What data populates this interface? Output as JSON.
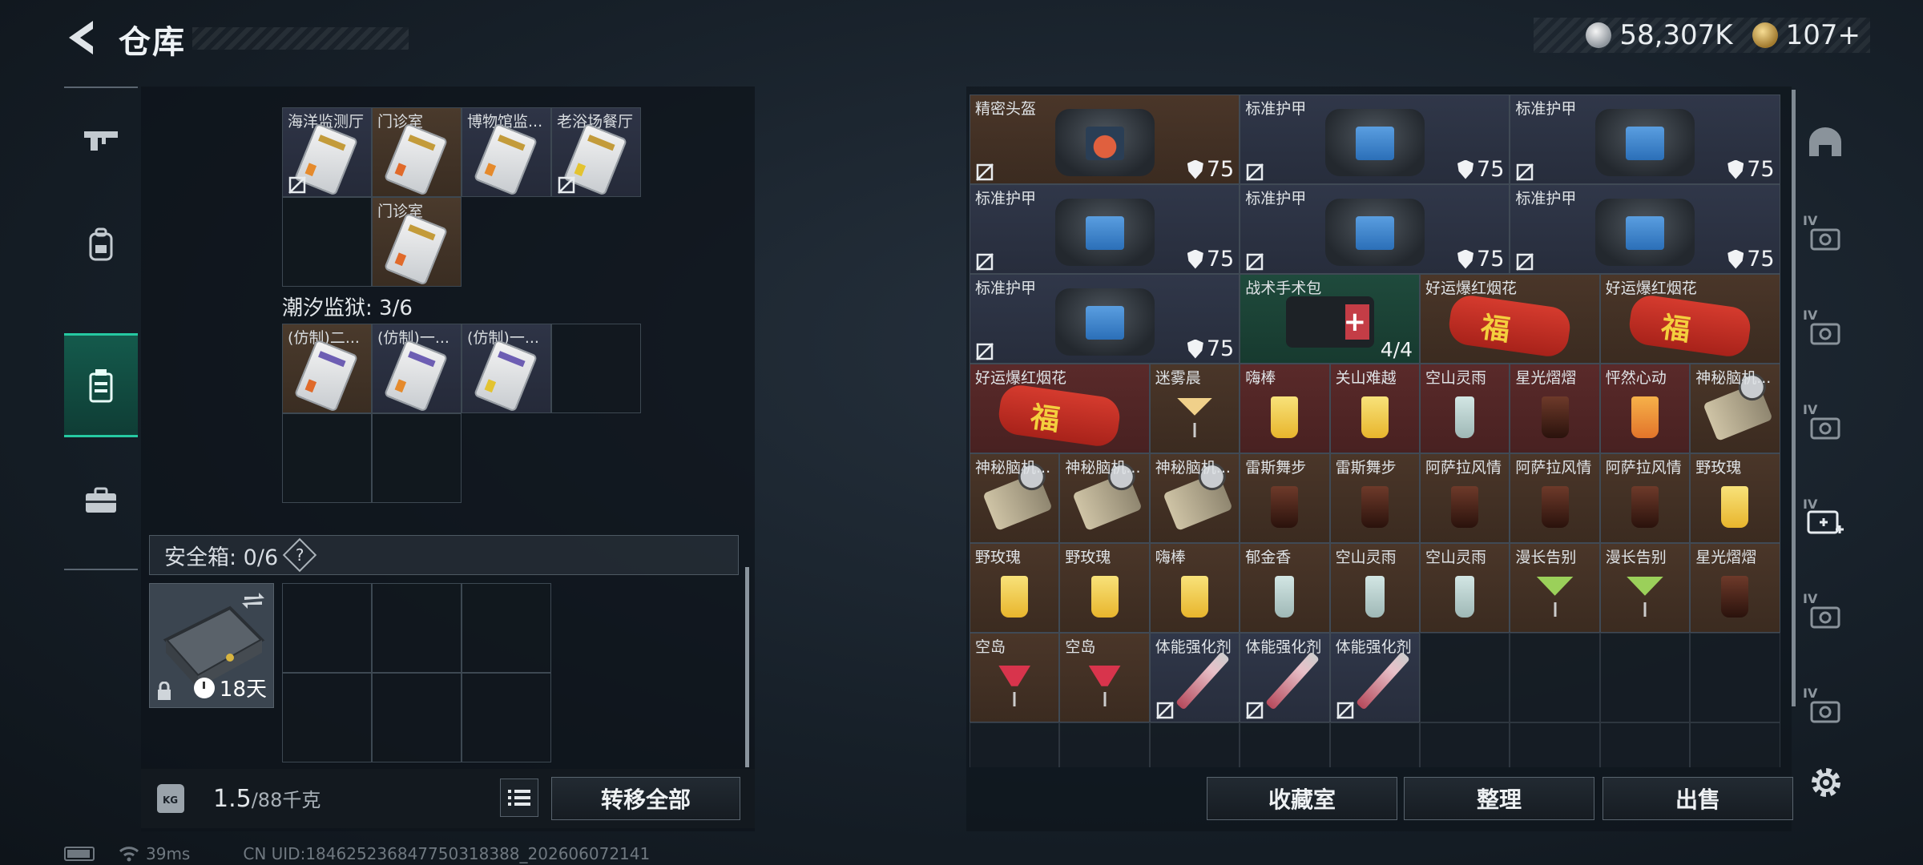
{
  "header": {
    "title": "仓库"
  },
  "currency": {
    "silver": "58,307K",
    "gold": "107+"
  },
  "left_nav": [
    {
      "name": "weapon",
      "icon": "gun-icon"
    },
    {
      "name": "backpack",
      "icon": "backpack-icon"
    },
    {
      "name": "container",
      "icon": "container-icon"
    },
    {
      "name": "briefcase",
      "icon": "briefcase-icon"
    }
  ],
  "keycards_top": {
    "row1": [
      "海洋监测厅",
      "门诊室",
      "博物馆监...",
      "老浴场餐厅"
    ],
    "row2": [
      "",
      "门诊室"
    ]
  },
  "tide_prison": {
    "label": "潮汐监狱: 3/6",
    "items": [
      "(仿制)二...",
      "(仿制)一...",
      "(仿制)一..."
    ]
  },
  "safebox": {
    "label": "安全箱: 0/6",
    "help": "?",
    "days": "18天"
  },
  "weight": {
    "current": "1.5",
    "max": "/88千克",
    "badge": "KG"
  },
  "buttons": {
    "transfer_all": "转移全部",
    "collection": "收藏室",
    "organize": "整理",
    "sell": "出售"
  },
  "status": {
    "latency": "39ms",
    "uid": "CN UID:1846252368477503183​88_202606072141"
  },
  "warehouse": {
    "big_rows": [
      [
        {
          "label": "精密头盔",
          "value": "75",
          "kind": "helmet",
          "color": "brown"
        },
        {
          "label": "标准护甲",
          "value": "75",
          "kind": "vest",
          "color": "blue"
        },
        {
          "label": "标准护甲",
          "value": "75",
          "kind": "vest",
          "color": "blue"
        }
      ],
      [
        {
          "label": "标准护甲",
          "value": "75",
          "kind": "vest",
          "color": "blue"
        },
        {
          "label": "标准护甲",
          "value": "75",
          "kind": "vest",
          "color": "blue"
        },
        {
          "label": "标准护甲",
          "value": "75",
          "kind": "vest",
          "color": "blue"
        }
      ]
    ],
    "row3": [
      {
        "label": "标准护甲",
        "value": "75",
        "kind": "vest",
        "color": "blue"
      },
      {
        "label": "战术手术包",
        "value": "4/4",
        "kind": "medkit",
        "color": "green"
      },
      {
        "label": "好运爆红烟花",
        "kind": "firework",
        "color": "brown"
      },
      {
        "label": "好运爆红烟花",
        "kind": "firework",
        "color": "brown"
      }
    ],
    "row4": [
      {
        "label": "好运爆红烟花",
        "kind": "firework",
        "color": "red"
      },
      {
        "label": "迷雾晨",
        "kind": "cocktail",
        "color": "brown"
      },
      {
        "label": "嗨棒",
        "kind": "yellow",
        "color": "red"
      },
      {
        "label": "关山难越",
        "kind": "yellow",
        "color": "red"
      },
      {
        "label": "空山灵雨",
        "kind": "clear",
        "color": "red"
      },
      {
        "label": "星光熠熠",
        "kind": "cola",
        "color": "red"
      },
      {
        "label": "怦然心动",
        "kind": "orange",
        "color": "red"
      },
      {
        "label": "神秘脑机...",
        "kind": "cable",
        "color": "brown"
      }
    ],
    "row5": [
      {
        "label": "神秘脑机...",
        "kind": "cable",
        "color": "brown"
      },
      {
        "label": "神秘脑机...",
        "kind": "cable",
        "color": "brown"
      },
      {
        "label": "神秘脑机...",
        "kind": "cable",
        "color": "brown"
      },
      {
        "label": "雷斯舞步",
        "kind": "cola",
        "color": "brown"
      },
      {
        "label": "雷斯舞步",
        "kind": "cola",
        "color": "brown"
      },
      {
        "label": "阿萨拉风情",
        "kind": "cola",
        "color": "brown"
      },
      {
        "label": "阿萨拉风情",
        "kind": "cola",
        "color": "brown"
      },
      {
        "label": "阿萨拉风情",
        "kind": "cola",
        "color": "brown"
      },
      {
        "label": "野玫瑰",
        "kind": "yellow",
        "color": "brown"
      }
    ],
    "row6": [
      {
        "label": "野玫瑰",
        "kind": "yellow",
        "color": "brown"
      },
      {
        "label": "野玫瑰",
        "kind": "yellow",
        "color": "brown"
      },
      {
        "label": "嗨棒",
        "kind": "yellow",
        "color": "brown"
      },
      {
        "label": "郁金香",
        "kind": "clear",
        "color": "brown"
      },
      {
        "label": "空山灵雨",
        "kind": "clear",
        "color": "brown"
      },
      {
        "label": "空山灵雨",
        "kind": "clear",
        "color": "brown"
      },
      {
        "label": "漫长告别",
        "kind": "martini",
        "color": "brown"
      },
      {
        "label": "漫长告别",
        "kind": "martini",
        "color": "brown"
      },
      {
        "label": "星光熠熠",
        "kind": "cola",
        "color": "brown"
      }
    ],
    "row7": [
      {
        "label": "空岛",
        "kind": "pink",
        "color": "brown"
      },
      {
        "label": "空岛",
        "kind": "pink",
        "color": "brown"
      },
      {
        "label": "体能强化剂",
        "kind": "syringe",
        "color": "blue"
      },
      {
        "label": "体能强化剂",
        "kind": "syringe",
        "color": "blue"
      },
      {
        "label": "体能强化剂",
        "kind": "syringe",
        "color": "blue"
      }
    ]
  },
  "right_rail": [
    {
      "name": "helmet-category",
      "tag": ""
    },
    {
      "name": "armor-iv-category",
      "tag": "IV"
    },
    {
      "name": "weapon-iv-category",
      "tag": "IV"
    },
    {
      "name": "ammo-iv-category",
      "tag": "IV"
    },
    {
      "name": "medical-iv-category",
      "tag": "IV"
    },
    {
      "name": "consumable-iv-category",
      "tag": "IV"
    },
    {
      "name": "misc-iv-category",
      "tag": "IV"
    }
  ]
}
